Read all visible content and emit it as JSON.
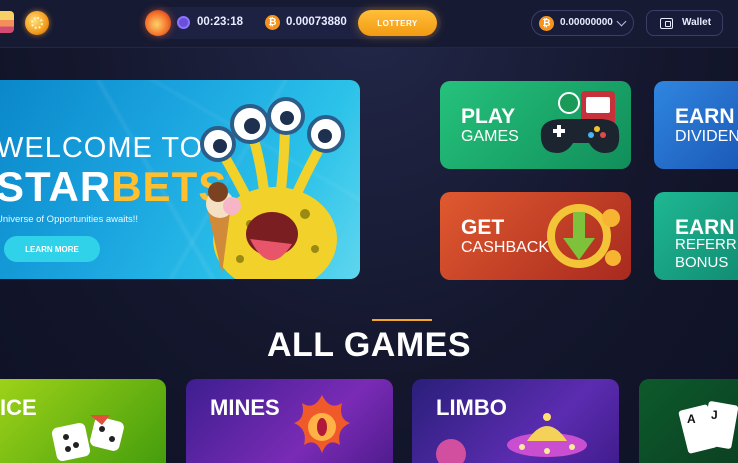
{
  "header": {
    "timer": "00:23:18",
    "jackpot_amount": "0.00073880",
    "lottery_label": "LOTTERY",
    "balance": "0.00000000",
    "wallet_label": "Wallet",
    "currency_symbol": "₿"
  },
  "hero": {
    "welcome": "WELCOME TO",
    "brand_part1": "STAR",
    "brand_part2": "BETS",
    "tagline": "Universe of Opportunities awaits!!",
    "cta": "LEARN MORE"
  },
  "promos": [
    {
      "line1": "PLAY",
      "line2": "GAMES"
    },
    {
      "line1": "GET",
      "line2": "CASHBACK"
    },
    {
      "line1": "EARN",
      "line2": "DIVIDEN"
    },
    {
      "line1": "EARN",
      "line2a": "REFERR",
      "line2b": "BONUS"
    }
  ],
  "section": {
    "title": "ALL GAMES"
  },
  "games": [
    {
      "name": "ICE"
    },
    {
      "name": "MINES"
    },
    {
      "name": "LIMBO"
    }
  ],
  "colors": {
    "accent": "#f4a626",
    "brand_yellow": "#ffbf2f",
    "background": "#14172d"
  }
}
